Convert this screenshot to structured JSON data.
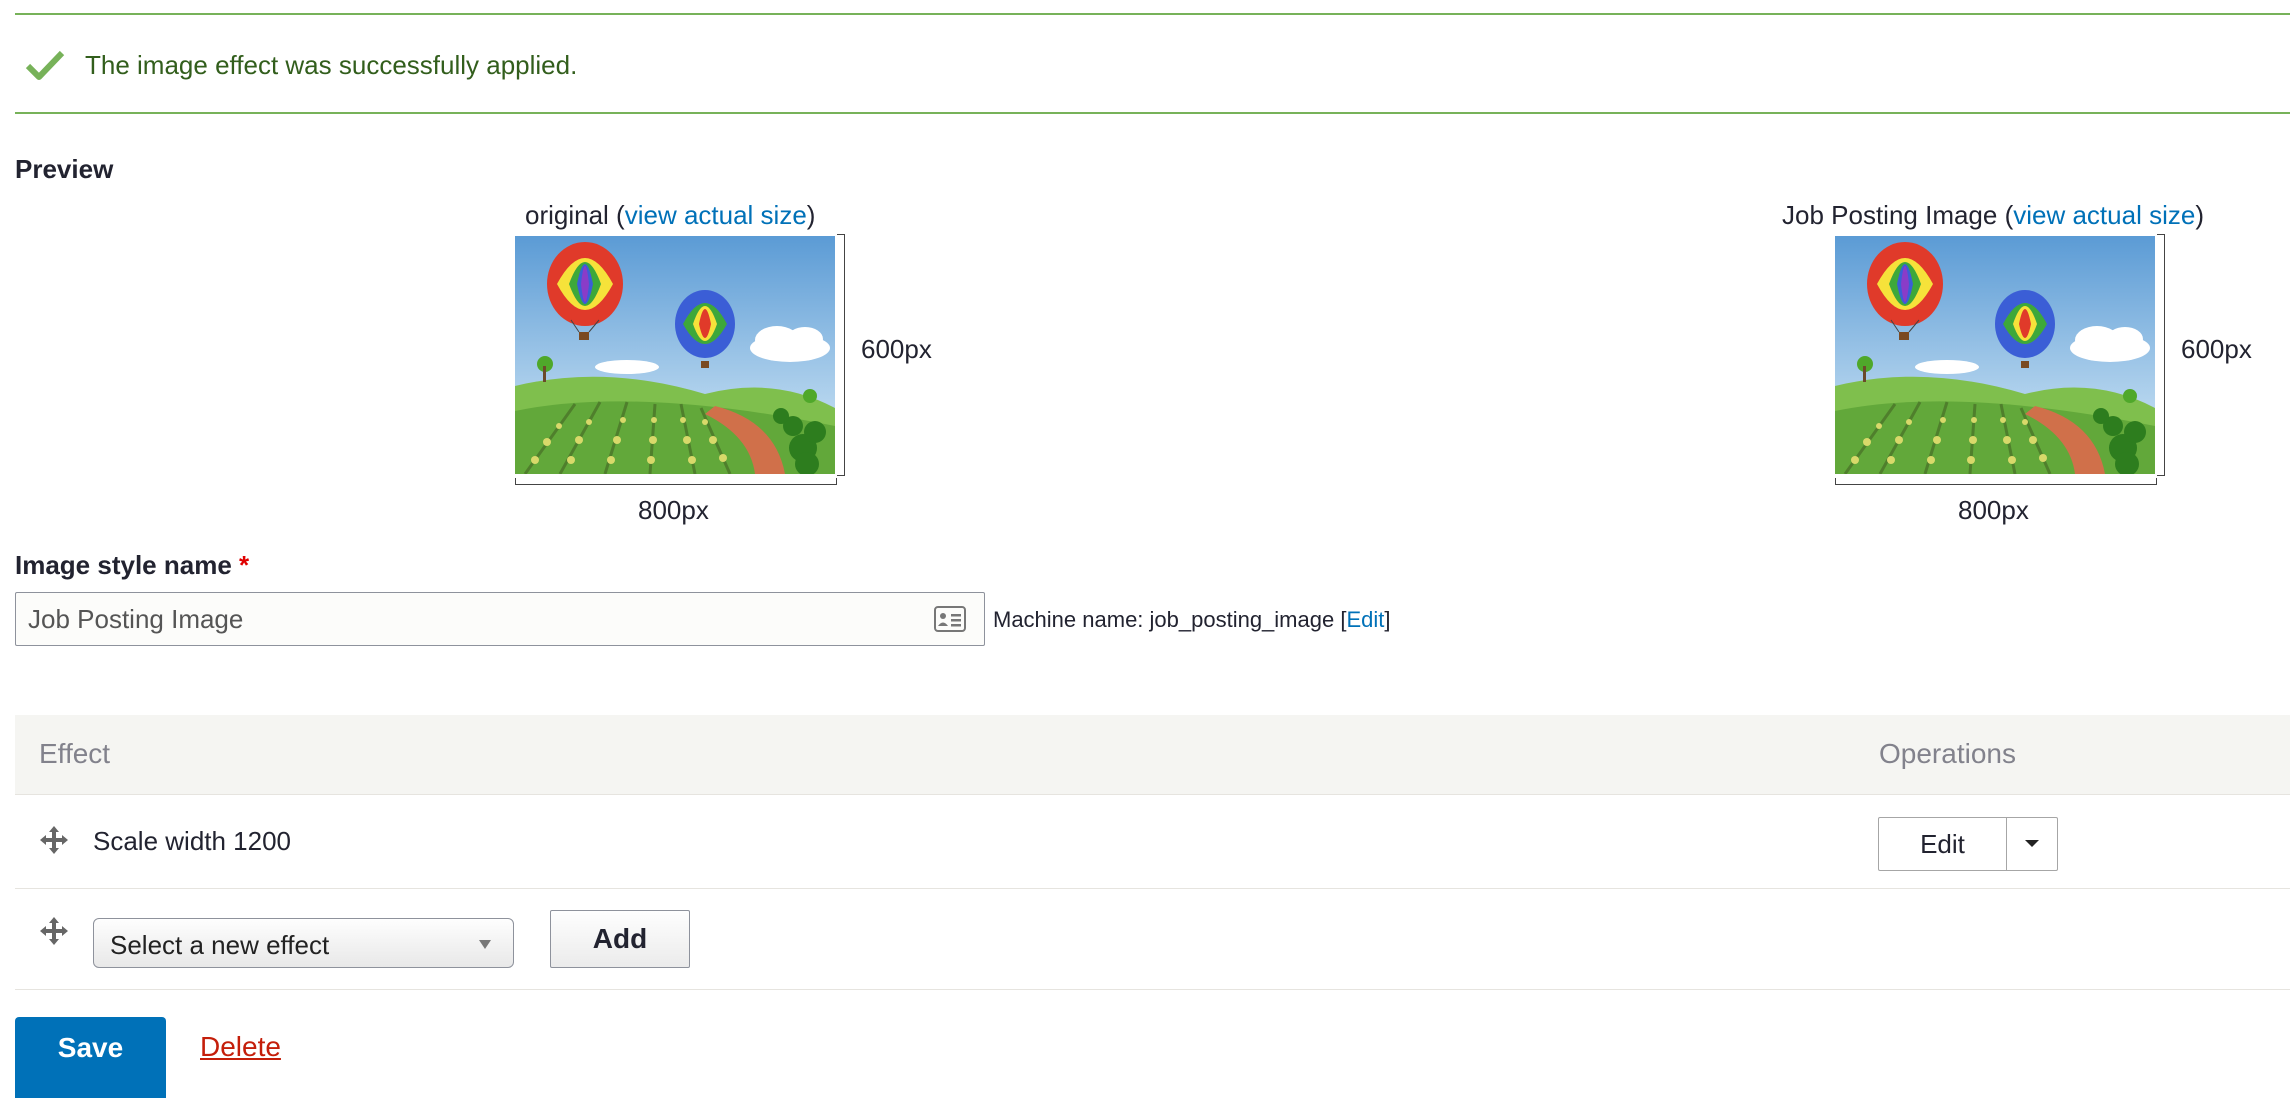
{
  "message": {
    "text": "The image effect was successfully applied.",
    "icon": "checkmark-icon",
    "color": "#77b259"
  },
  "preview": {
    "heading": "Preview",
    "original": {
      "caption_prefix": "original (",
      "link": "view actual size",
      "caption_suffix": ")",
      "width_label": "800px",
      "height_label": "600px"
    },
    "styled": {
      "caption_prefix": "Job Posting Image (",
      "link": "view actual size",
      "caption_suffix": ")",
      "width_label": "800px",
      "height_label": "600px"
    }
  },
  "form": {
    "name_label": "Image style name",
    "required_marker": "*",
    "name_value": "Job Posting Image",
    "machine_prefix": "Machine name: job_posting_image [",
    "machine_edit": "Edit",
    "machine_suffix": "]"
  },
  "effects_table": {
    "col_effect": "Effect",
    "col_operations": "Operations",
    "rows": [
      {
        "effect": "Scale width 1200",
        "operation": "Edit"
      }
    ],
    "new_effect_select": "Select a new effect",
    "add_button": "Add"
  },
  "actions": {
    "save": "Save",
    "delete": "Delete",
    "accent": "#0071b8",
    "danger": "#c41e0a"
  }
}
